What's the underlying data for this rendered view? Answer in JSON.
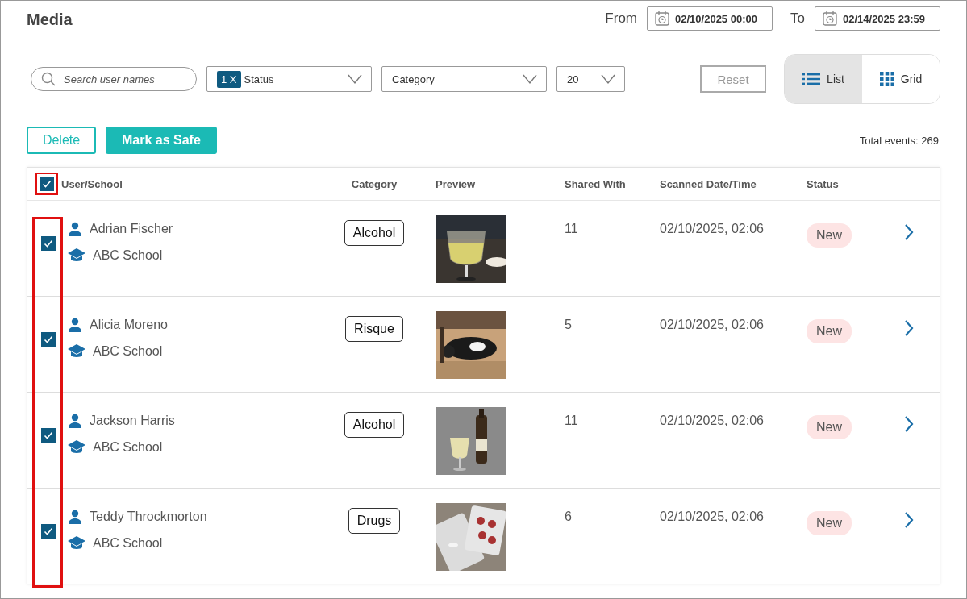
{
  "header": {
    "title": "Media",
    "from_label": "From",
    "from_value": "02/10/2025 00:00",
    "to_label": "To",
    "to_value": "02/14/2025 23:59"
  },
  "filters": {
    "search": {
      "placeholder": "Search user names"
    },
    "status": {
      "chip": "1 X",
      "label": "Status"
    },
    "category": {
      "label": "Category"
    },
    "page_size": {
      "value": "20"
    },
    "reset": {
      "label": "Reset",
      "disabled": true
    },
    "views": [
      {
        "label": "List",
        "kind": "list",
        "selected": true
      },
      {
        "label": "Grid",
        "kind": "grid",
        "selected": false
      }
    ]
  },
  "actions": {
    "delete": "Delete",
    "mark_safe": "Mark as Safe",
    "total": "Total events: 269"
  },
  "table": {
    "select_all": {
      "checked": true,
      "highlighted": true
    },
    "checkbox_column_highlighted": true,
    "columns": [
      "User/School",
      "Category",
      "Preview",
      "Shared With",
      "Scanned Date/Time",
      "Status"
    ],
    "rows": [
      {
        "checked": true,
        "user": "Adrian Fischer",
        "school": "ABC School",
        "category": "Alcohol",
        "shared_with": "11",
        "scanned": "02/10/2025, 02:06",
        "status": "New"
      },
      {
        "checked": true,
        "user": "Alicia Moreno",
        "school": "ABC School",
        "category": "Risque",
        "shared_with": "5",
        "scanned": "02/10/2025, 02:06",
        "status": "New"
      },
      {
        "checked": true,
        "user": "Jackson Harris",
        "school": "ABC School",
        "category": "Alcohol",
        "shared_with": "11",
        "scanned": "02/10/2025, 02:06",
        "status": "New"
      },
      {
        "checked": true,
        "user": "Teddy Throckmorton",
        "school": "ABC School",
        "category": "Drugs",
        "shared_with": "6",
        "scanned": "02/10/2025, 02:06",
        "status": "New"
      }
    ]
  }
}
